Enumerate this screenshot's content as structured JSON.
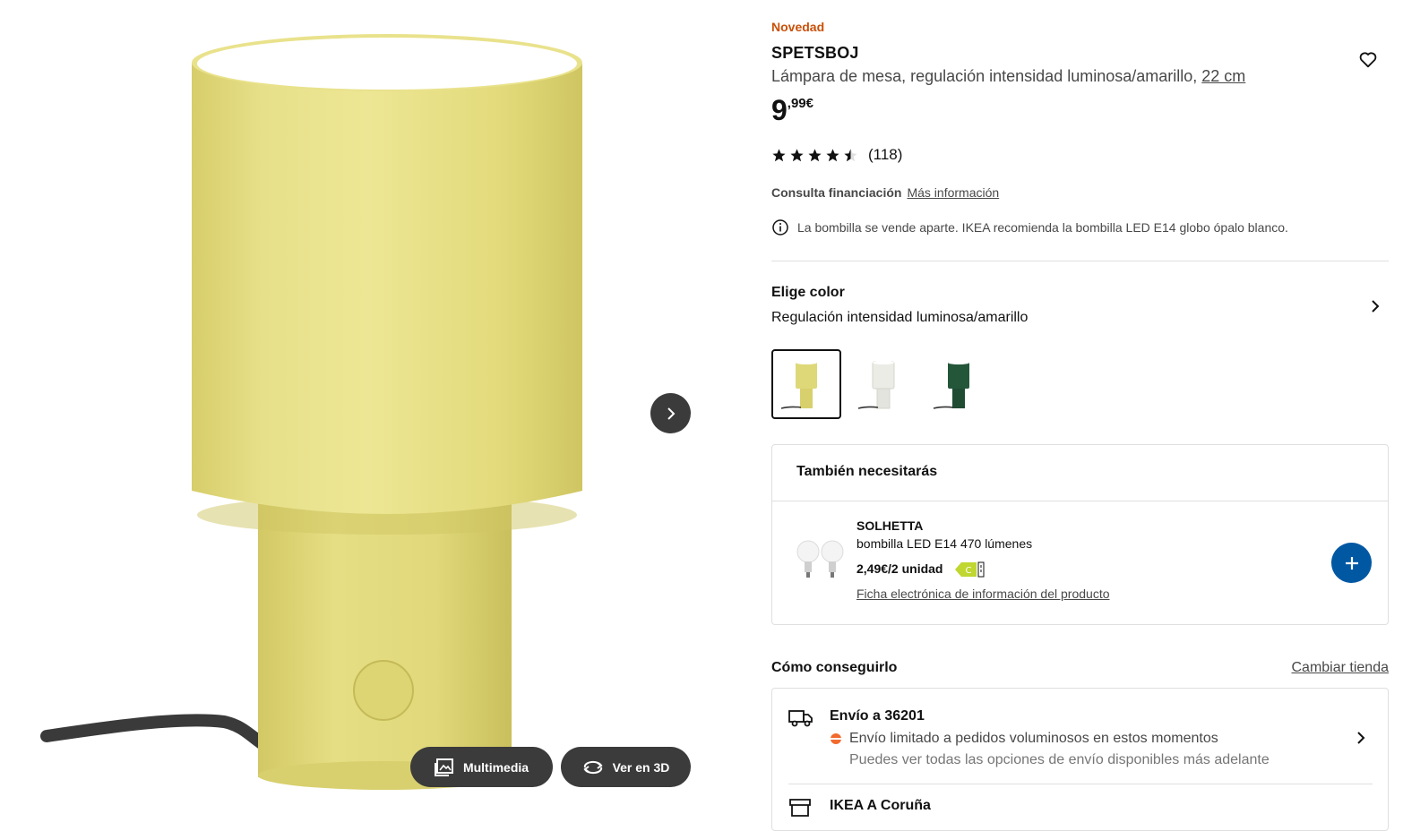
{
  "gallery": {
    "multimedia_label": "Multimedia",
    "view3d_label": "Ver en 3D"
  },
  "product": {
    "badge": "Novedad",
    "name": "SPETSBOJ",
    "description": "Lámpara de mesa, regulación intensidad luminosa/amarillo,",
    "size": "22 cm",
    "price_int": "9",
    "price_dec": ",99€",
    "rating_value": 4.5,
    "rating_count": "(118)"
  },
  "finance": {
    "label": "Consulta financiación",
    "link": "Más información"
  },
  "bulb_note": "La bombilla se vende aparte. IKEA recomienda la bombilla LED E14 globo ópalo blanco.",
  "color": {
    "title": "Elige color",
    "selected": "Regulación intensidad luminosa/amarillo",
    "swatches": [
      "#ded878",
      "#ecece6",
      "#24563a"
    ]
  },
  "also_need": {
    "title": "También necesitarás",
    "item_name": "SOLHETTA",
    "item_desc": "bombilla LED E14 470 lúmenes",
    "item_price": "2,49€/2 unidad",
    "energy_class": "C",
    "item_link": "Ficha electrónica de información del producto"
  },
  "how_to_get": {
    "title": "Cómo conseguirlo",
    "change_store": "Cambiar tienda",
    "delivery_title": "Envío a 36201",
    "delivery_status": "Envío limitado a pedidos voluminosos en estos momentos",
    "delivery_note": "Puedes ver todas las opciones de envío disponibles más adelante",
    "store_title": "IKEA A Coruña"
  },
  "colors": {
    "accent_blue": "#0058a3",
    "new_badge": "#ca5008",
    "lamp_yellow": "#e3db7c",
    "status_orange": "#f26a2e"
  }
}
